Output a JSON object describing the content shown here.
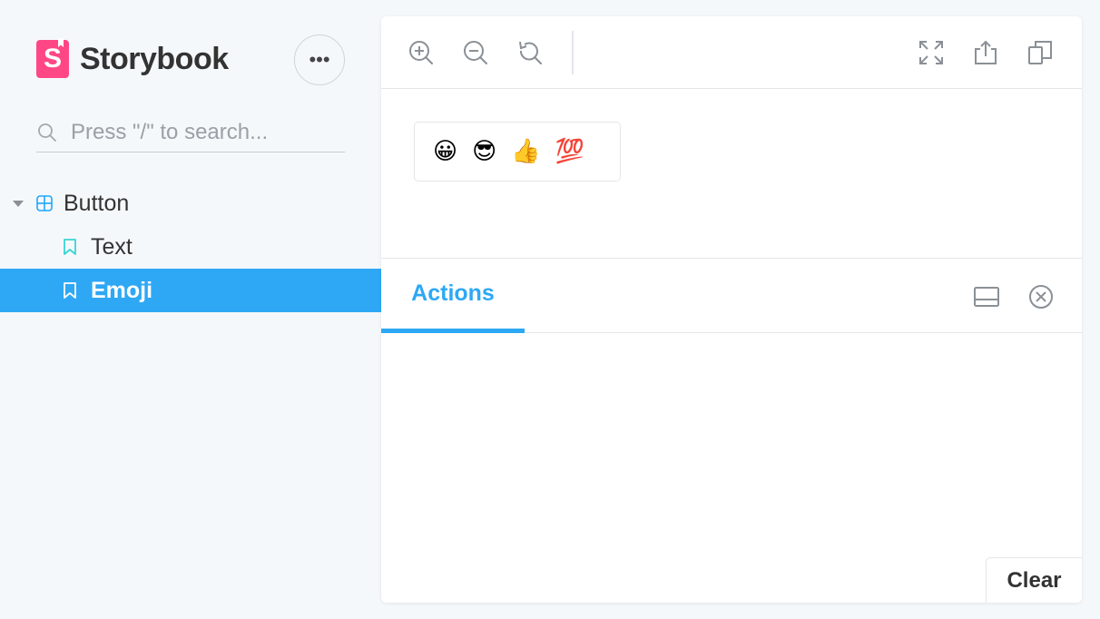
{
  "app": {
    "brand_letter": "S",
    "brand_name": "Storybook",
    "more_label": "•••",
    "brand_color": "#ff4785",
    "accent_color": "#2ea8f5"
  },
  "search": {
    "placeholder": "Press \"/\" to search...",
    "icon": "search-icon"
  },
  "sidebar": {
    "group": {
      "label": "Button",
      "icon": "component-icon",
      "expanded": true
    },
    "stories": [
      {
        "label": "Text",
        "icon": "bookmark-icon",
        "active": false
      },
      {
        "label": "Emoji",
        "icon": "bookmark-icon",
        "active": true
      }
    ]
  },
  "toolbar": {
    "tools": [
      "zoom-in-icon",
      "zoom-out-icon",
      "zoom-reset-icon",
      "fullscreen-icon",
      "share-icon",
      "copy-icon"
    ]
  },
  "canvas": {
    "emojis": [
      "😀",
      "😎",
      "👍",
      "💯"
    ]
  },
  "addons": {
    "active_tab": "Actions",
    "tools": [
      "panel-orientation-icon",
      "close-icon"
    ],
    "clear_label": "Clear"
  }
}
